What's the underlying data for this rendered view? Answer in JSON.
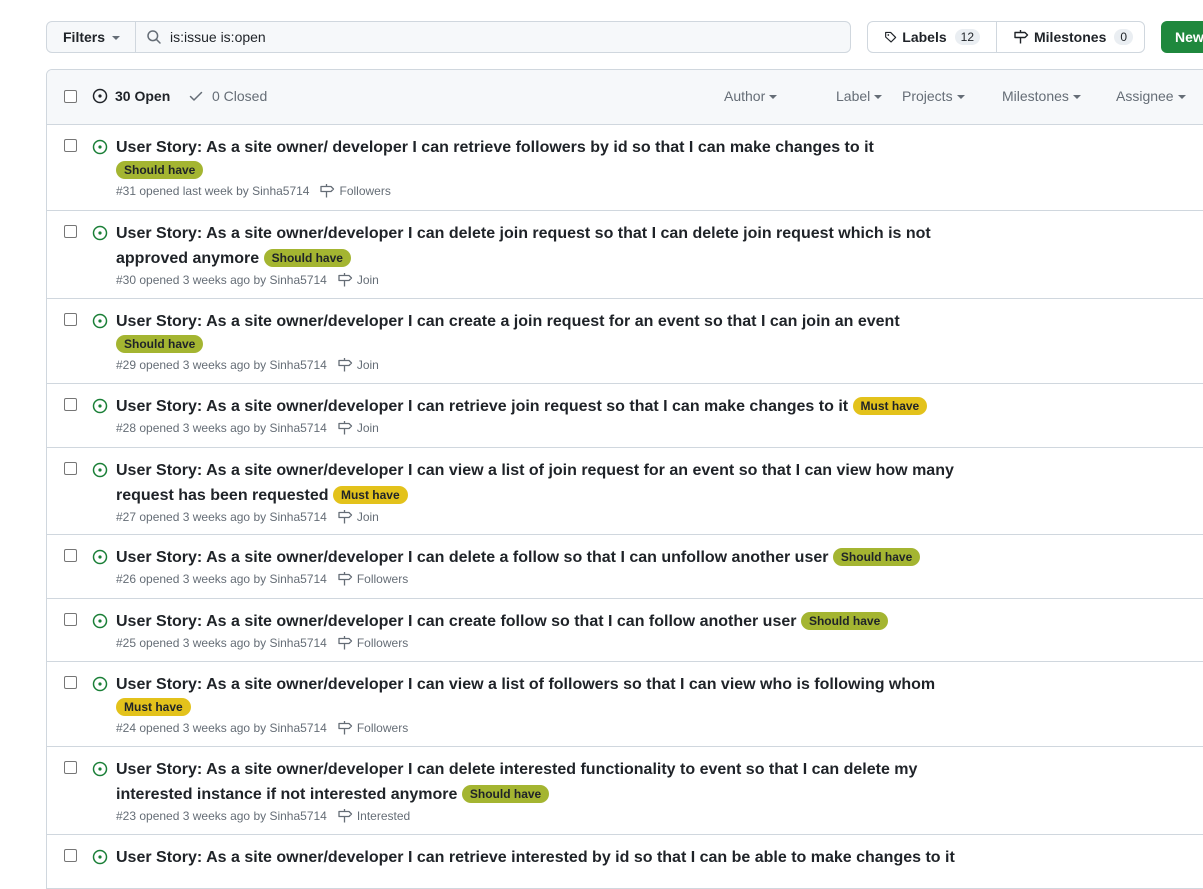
{
  "toolbar": {
    "filters_label": "Filters",
    "search_value": "is:issue is:open",
    "labels_label": "Labels",
    "labels_count": "12",
    "milestones_label": "Milestones",
    "milestones_count": "0",
    "new_label": "New"
  },
  "header": {
    "open_label": "30 Open",
    "closed_label": "0 Closed",
    "filters": [
      "Author",
      "Label",
      "Projects",
      "Milestones",
      "Assignee"
    ]
  },
  "colors": {
    "open_icon": "#1a7f37",
    "should_have": "#a4b531",
    "must_have": "#e3c21b",
    "new_button": "#1f883d"
  },
  "issues": [
    {
      "title": "User Story: As a site owner/ developer I can retrieve followers by id so that I can make changes to it",
      "label": "Should have",
      "label_kind": "should",
      "meta": "#31 opened last week by Sinha5714",
      "milestone": "Followers",
      "label_newline": true
    },
    {
      "title": "User Story: As a site owner/developer I can delete join request so that I can delete join request which is not approved anymore",
      "label": "Should have",
      "label_kind": "should",
      "meta": "#30 opened 3 weeks ago by Sinha5714",
      "milestone": "Join"
    },
    {
      "title": "User Story: As a site owner/developer I can create a join request for an event so that I can join an event",
      "label": "Should have",
      "label_kind": "should",
      "meta": "#29 opened 3 weeks ago by Sinha5714",
      "milestone": "Join",
      "label_newline": true
    },
    {
      "title": "User Story: As a site owner/developer I can retrieve join request so that I can make changes to it",
      "label": "Must have",
      "label_kind": "must",
      "meta": "#28 opened 3 weeks ago by Sinha5714",
      "milestone": "Join"
    },
    {
      "title": "User Story: As a site owner/developer I can view a list of join request for an event so that I can view how many request has been requested",
      "label": "Must have",
      "label_kind": "must",
      "meta": "#27 opened 3 weeks ago by Sinha5714",
      "milestone": "Join"
    },
    {
      "title": "User Story: As a site owner/developer I can delete a follow so that I can unfollow another user",
      "label": "Should have",
      "label_kind": "should",
      "meta": "#26 opened 3 weeks ago by Sinha5714",
      "milestone": "Followers"
    },
    {
      "title": "User Story: As a site owner/developer I can create follow so that I can follow another user",
      "label": "Should have",
      "label_kind": "should",
      "meta": "#25 opened 3 weeks ago by Sinha5714",
      "milestone": "Followers"
    },
    {
      "title": "User Story: As a site owner/developer I can view a list of followers so that I can view who is following whom",
      "label": "Must have",
      "label_kind": "must",
      "meta": "#24 opened 3 weeks ago by Sinha5714",
      "milestone": "Followers",
      "label_newline": true
    },
    {
      "title": "User Story: As a site owner/developer I can delete interested functionality to event so that I can delete my interested instance if not interested anymore",
      "label": "Should have",
      "label_kind": "should",
      "meta": "#23 opened 3 weeks ago by Sinha5714",
      "milestone": "Interested"
    },
    {
      "title": "User Story: As a site owner/developer I can retrieve interested by id so that I can be able to make changes to it",
      "label": "",
      "label_kind": "",
      "meta": "",
      "milestone": ""
    }
  ]
}
